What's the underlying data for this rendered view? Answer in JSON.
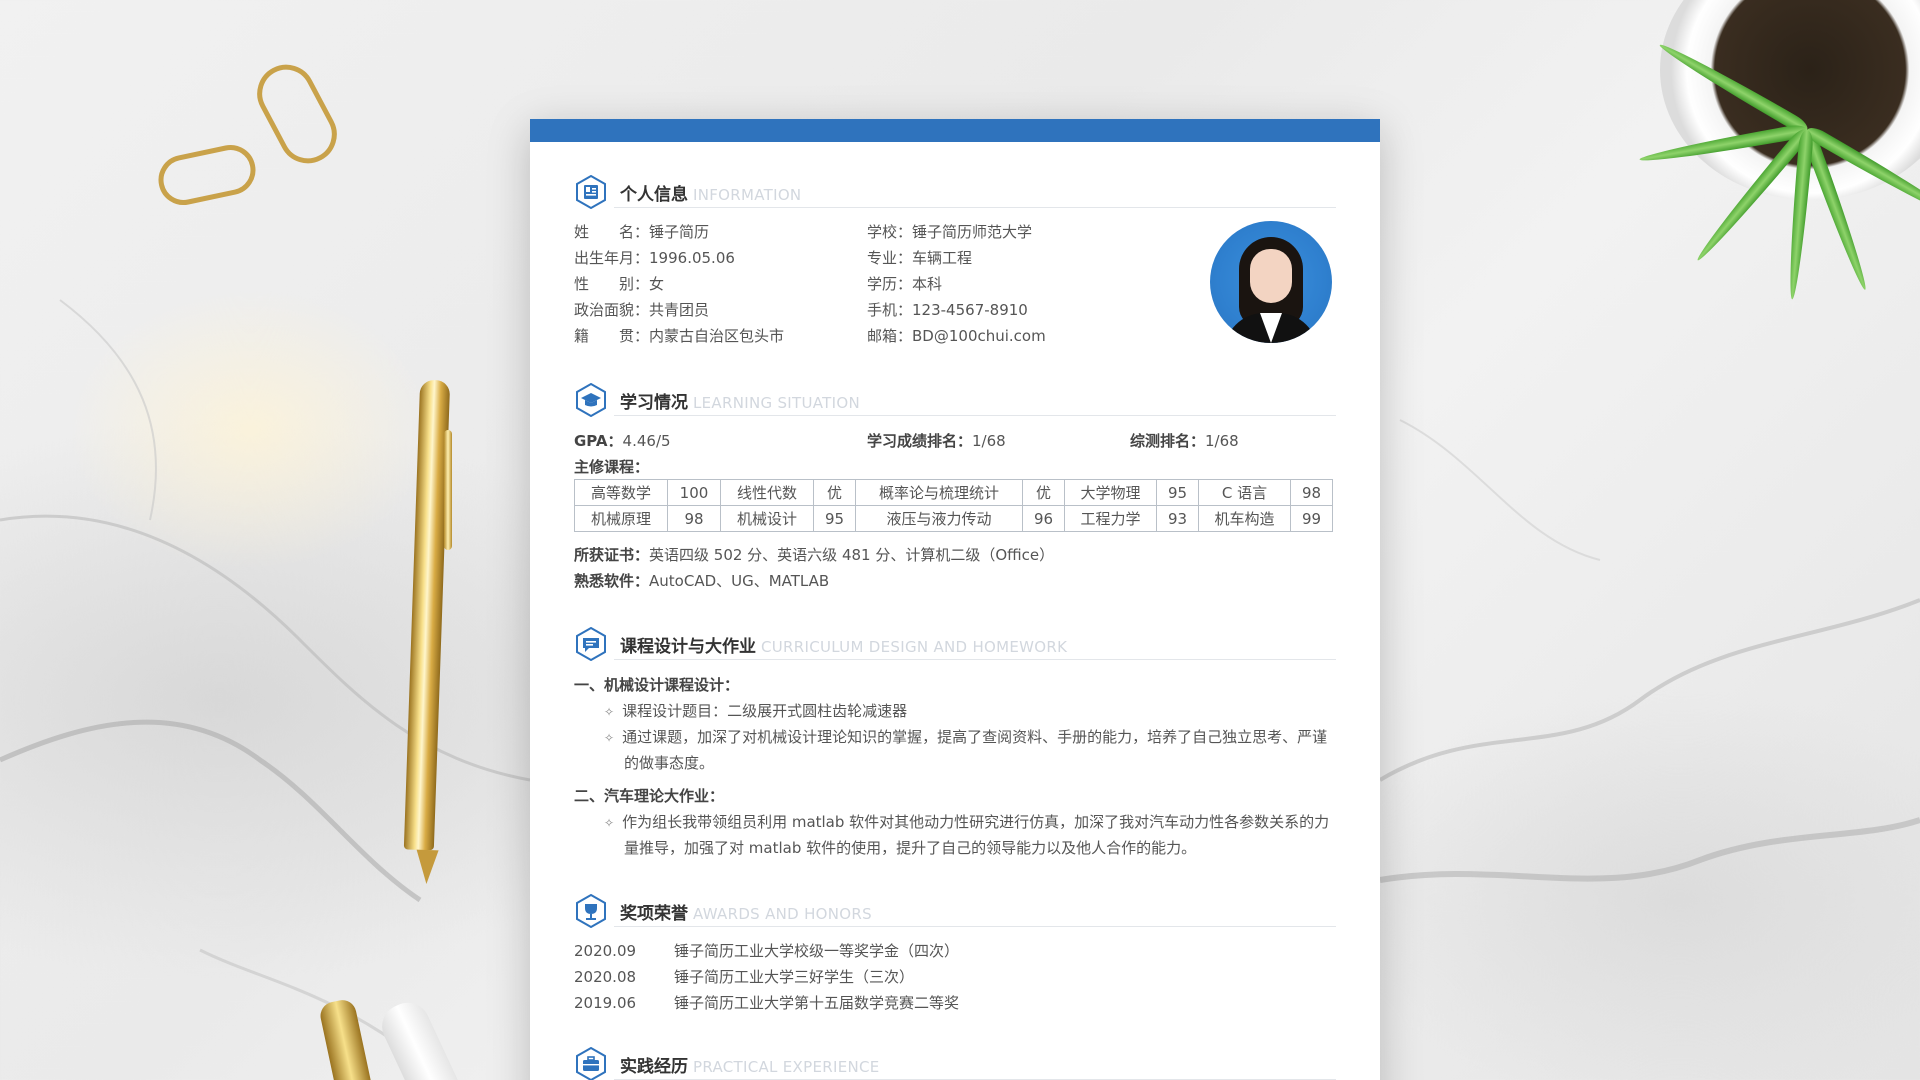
{
  "info": {
    "title": "个人信息",
    "subtitle": "INFORMATION",
    "left": [
      {
        "label": "姓　　名：",
        "value": "锤子简历"
      },
      {
        "label": "出生年月：",
        "value": "1996.05.06"
      },
      {
        "label": "性　　别：",
        "value": "女"
      },
      {
        "label": "政治面貌：",
        "value": "共青团员"
      },
      {
        "label": "籍　　贯：",
        "value": "内蒙古自治区包头市"
      }
    ],
    "right": [
      {
        "label": "学校：",
        "value": "锤子简历师范大学"
      },
      {
        "label": "专业：",
        "value": "车辆工程"
      },
      {
        "label": "学历：",
        "value": "本科"
      },
      {
        "label": "手机：",
        "value": "123-4567-8910"
      },
      {
        "label": "邮箱：",
        "value": "BD@100chui.com"
      }
    ]
  },
  "study": {
    "title": "学习情况",
    "subtitle": "LEARNING SITUATION",
    "gpa_label": "GPA：",
    "gpa_value": "4.46/5",
    "rank_label": "学习成绩排名：",
    "rank_value": "1/68",
    "overall_label": "综测排名：",
    "overall_value": "1/68",
    "courses_label": "主修课程：",
    "courses": [
      [
        "高等数学",
        "100",
        "线性代数",
        "优",
        "概率论与梳理统计",
        "优",
        "大学物理",
        "95",
        "C 语言",
        "98"
      ],
      [
        "机械原理",
        "98",
        "机械设计",
        "95",
        "液压与液力传动",
        "96",
        "工程力学",
        "93",
        "机车构造",
        "99"
      ]
    ],
    "cert_label": "所获证书：",
    "cert_value": "英语四级 502 分、英语六级 481 分、计算机二级（Office）",
    "software_label": "熟悉软件：",
    "software_value": "AutoCAD、UG、MATLAB"
  },
  "course_design": {
    "title": "课程设计与大作业",
    "subtitle": "CURRICULUM DESIGN AND HOMEWORK",
    "item1_title": "一、机械设计课程设计：",
    "item1_b1": "课程设计题目：二级展开式圆柱齿轮减速器",
    "item1_b2_l1": "通过课题，加深了对机械设计理论知识的掌握，提高了查阅资料、手册的能力，培养了自己独立思考、严谨",
    "item1_b2_l2": "的做事态度。",
    "item2_title": "二、汽车理论大作业：",
    "item2_b1_l1": "作为组长我带领组员利用 matlab 软件对其他动力性研究进行仿真，加深了我对汽车动力性各参数关系的力",
    "item2_b1_l2": "量推导，加强了对 matlab 软件的使用，提升了自己的领导能力以及他人合作的能力。",
    "bullet": "✧"
  },
  "awards": {
    "title": "奖项荣誉",
    "subtitle": "AWARDS AND HONORS",
    "items": [
      {
        "date": "2020.09",
        "text": "锤子简历工业大学校级一等奖学金（四次）"
      },
      {
        "date": "2020.08",
        "text": "锤子简历工业大学三好学生（三次）"
      },
      {
        "date": "2019.06",
        "text": "锤子简历工业大学第十五届数学竞赛二等奖"
      }
    ]
  },
  "practice": {
    "title": "实践经历",
    "subtitle": "PRACTICAL EXPERIENCE"
  },
  "colors": {
    "accent": "#2f73bd",
    "text": "#555555",
    "subtitle": "#d2d7de"
  },
  "icons": [
    "profile-card-icon",
    "graduation-cap-icon",
    "chat-icon",
    "trophy-icon",
    "briefcase-icon"
  ]
}
